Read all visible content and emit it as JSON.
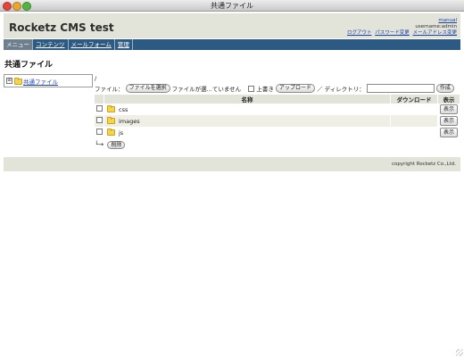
{
  "window": {
    "title": "共通ファイル"
  },
  "header": {
    "site_title": "Rocketz CMS test",
    "manual_link": "manual",
    "username": "username:admin",
    "links": [
      "ログアウト",
      "パスワード変更",
      "メールアドレス変更"
    ]
  },
  "nav": {
    "items": [
      {
        "label": "メニュー",
        "active": true
      },
      {
        "label": "コンテンツ",
        "active": false
      },
      {
        "label": "メールフォーム",
        "active": false
      },
      {
        "label": "管理",
        "active": false
      }
    ]
  },
  "page": {
    "heading": "共通ファイル"
  },
  "tree": {
    "toggle": "⊞",
    "root_label": "共通ファイル"
  },
  "upload": {
    "path": "/",
    "file_label": "ファイル：",
    "choose_button": "ファイルを選択",
    "no_file_text": "ファイルが選...ていません",
    "overwrite_label": "上書き",
    "upload_button": "アップロード",
    "dir_label": "／ ディレクトリ：",
    "dir_value": "",
    "create_button": "作成"
  },
  "table": {
    "headers": {
      "name": "名称",
      "download": "ダウンロード",
      "view": "表示"
    },
    "rows": [
      {
        "name": "css",
        "action": "表示"
      },
      {
        "name": "images",
        "action": "表示"
      },
      {
        "name": "js",
        "action": "表示"
      }
    ]
  },
  "bulk": {
    "arrow": "└→",
    "delete_button": "削除"
  },
  "footer": {
    "copyright": "copyright Rocketz Co.,Ltd."
  },
  "colors": {
    "nav_bg": "#2d5a82",
    "header_bg": "#e2e3d9",
    "link": "#1a3fa8",
    "folder": "#f6d54a"
  }
}
